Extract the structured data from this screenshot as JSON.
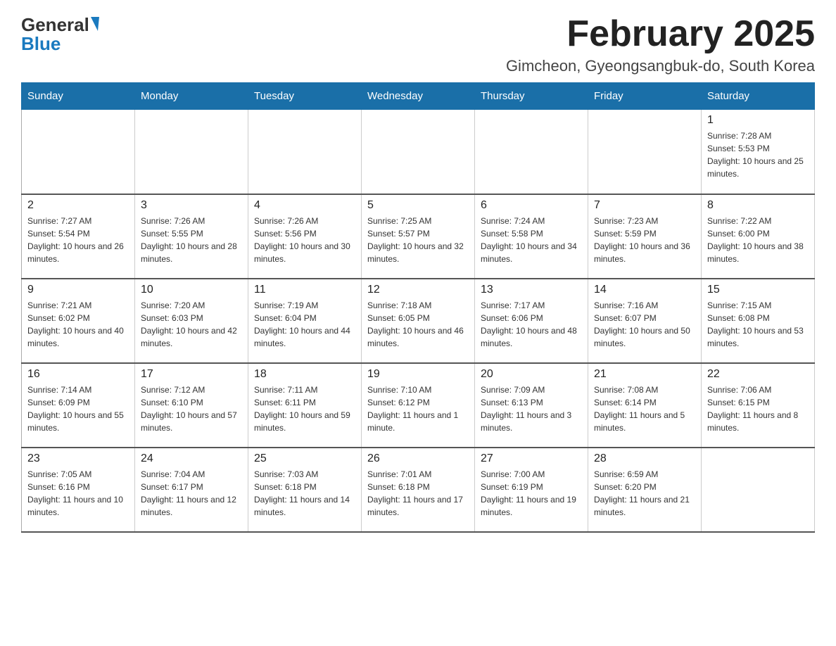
{
  "header": {
    "logo_general": "General",
    "logo_blue": "Blue",
    "title": "February 2025",
    "subtitle": "Gimcheon, Gyeongsangbuk-do, South Korea"
  },
  "calendar": {
    "days_of_week": [
      "Sunday",
      "Monday",
      "Tuesday",
      "Wednesday",
      "Thursday",
      "Friday",
      "Saturday"
    ],
    "weeks": [
      [
        {
          "day": "",
          "sunrise": "",
          "sunset": "",
          "daylight": ""
        },
        {
          "day": "",
          "sunrise": "",
          "sunset": "",
          "daylight": ""
        },
        {
          "day": "",
          "sunrise": "",
          "sunset": "",
          "daylight": ""
        },
        {
          "day": "",
          "sunrise": "",
          "sunset": "",
          "daylight": ""
        },
        {
          "day": "",
          "sunrise": "",
          "sunset": "",
          "daylight": ""
        },
        {
          "day": "",
          "sunrise": "",
          "sunset": "",
          "daylight": ""
        },
        {
          "day": "1",
          "sunrise": "Sunrise: 7:28 AM",
          "sunset": "Sunset: 5:53 PM",
          "daylight": "Daylight: 10 hours and 25 minutes."
        }
      ],
      [
        {
          "day": "2",
          "sunrise": "Sunrise: 7:27 AM",
          "sunset": "Sunset: 5:54 PM",
          "daylight": "Daylight: 10 hours and 26 minutes."
        },
        {
          "day": "3",
          "sunrise": "Sunrise: 7:26 AM",
          "sunset": "Sunset: 5:55 PM",
          "daylight": "Daylight: 10 hours and 28 minutes."
        },
        {
          "day": "4",
          "sunrise": "Sunrise: 7:26 AM",
          "sunset": "Sunset: 5:56 PM",
          "daylight": "Daylight: 10 hours and 30 minutes."
        },
        {
          "day": "5",
          "sunrise": "Sunrise: 7:25 AM",
          "sunset": "Sunset: 5:57 PM",
          "daylight": "Daylight: 10 hours and 32 minutes."
        },
        {
          "day": "6",
          "sunrise": "Sunrise: 7:24 AM",
          "sunset": "Sunset: 5:58 PM",
          "daylight": "Daylight: 10 hours and 34 minutes."
        },
        {
          "day": "7",
          "sunrise": "Sunrise: 7:23 AM",
          "sunset": "Sunset: 5:59 PM",
          "daylight": "Daylight: 10 hours and 36 minutes."
        },
        {
          "day": "8",
          "sunrise": "Sunrise: 7:22 AM",
          "sunset": "Sunset: 6:00 PM",
          "daylight": "Daylight: 10 hours and 38 minutes."
        }
      ],
      [
        {
          "day": "9",
          "sunrise": "Sunrise: 7:21 AM",
          "sunset": "Sunset: 6:02 PM",
          "daylight": "Daylight: 10 hours and 40 minutes."
        },
        {
          "day": "10",
          "sunrise": "Sunrise: 7:20 AM",
          "sunset": "Sunset: 6:03 PM",
          "daylight": "Daylight: 10 hours and 42 minutes."
        },
        {
          "day": "11",
          "sunrise": "Sunrise: 7:19 AM",
          "sunset": "Sunset: 6:04 PM",
          "daylight": "Daylight: 10 hours and 44 minutes."
        },
        {
          "day": "12",
          "sunrise": "Sunrise: 7:18 AM",
          "sunset": "Sunset: 6:05 PM",
          "daylight": "Daylight: 10 hours and 46 minutes."
        },
        {
          "day": "13",
          "sunrise": "Sunrise: 7:17 AM",
          "sunset": "Sunset: 6:06 PM",
          "daylight": "Daylight: 10 hours and 48 minutes."
        },
        {
          "day": "14",
          "sunrise": "Sunrise: 7:16 AM",
          "sunset": "Sunset: 6:07 PM",
          "daylight": "Daylight: 10 hours and 50 minutes."
        },
        {
          "day": "15",
          "sunrise": "Sunrise: 7:15 AM",
          "sunset": "Sunset: 6:08 PM",
          "daylight": "Daylight: 10 hours and 53 minutes."
        }
      ],
      [
        {
          "day": "16",
          "sunrise": "Sunrise: 7:14 AM",
          "sunset": "Sunset: 6:09 PM",
          "daylight": "Daylight: 10 hours and 55 minutes."
        },
        {
          "day": "17",
          "sunrise": "Sunrise: 7:12 AM",
          "sunset": "Sunset: 6:10 PM",
          "daylight": "Daylight: 10 hours and 57 minutes."
        },
        {
          "day": "18",
          "sunrise": "Sunrise: 7:11 AM",
          "sunset": "Sunset: 6:11 PM",
          "daylight": "Daylight: 10 hours and 59 minutes."
        },
        {
          "day": "19",
          "sunrise": "Sunrise: 7:10 AM",
          "sunset": "Sunset: 6:12 PM",
          "daylight": "Daylight: 11 hours and 1 minute."
        },
        {
          "day": "20",
          "sunrise": "Sunrise: 7:09 AM",
          "sunset": "Sunset: 6:13 PM",
          "daylight": "Daylight: 11 hours and 3 minutes."
        },
        {
          "day": "21",
          "sunrise": "Sunrise: 7:08 AM",
          "sunset": "Sunset: 6:14 PM",
          "daylight": "Daylight: 11 hours and 5 minutes."
        },
        {
          "day": "22",
          "sunrise": "Sunrise: 7:06 AM",
          "sunset": "Sunset: 6:15 PM",
          "daylight": "Daylight: 11 hours and 8 minutes."
        }
      ],
      [
        {
          "day": "23",
          "sunrise": "Sunrise: 7:05 AM",
          "sunset": "Sunset: 6:16 PM",
          "daylight": "Daylight: 11 hours and 10 minutes."
        },
        {
          "day": "24",
          "sunrise": "Sunrise: 7:04 AM",
          "sunset": "Sunset: 6:17 PM",
          "daylight": "Daylight: 11 hours and 12 minutes."
        },
        {
          "day": "25",
          "sunrise": "Sunrise: 7:03 AM",
          "sunset": "Sunset: 6:18 PM",
          "daylight": "Daylight: 11 hours and 14 minutes."
        },
        {
          "day": "26",
          "sunrise": "Sunrise: 7:01 AM",
          "sunset": "Sunset: 6:18 PM",
          "daylight": "Daylight: 11 hours and 17 minutes."
        },
        {
          "day": "27",
          "sunrise": "Sunrise: 7:00 AM",
          "sunset": "Sunset: 6:19 PM",
          "daylight": "Daylight: 11 hours and 19 minutes."
        },
        {
          "day": "28",
          "sunrise": "Sunrise: 6:59 AM",
          "sunset": "Sunset: 6:20 PM",
          "daylight": "Daylight: 11 hours and 21 minutes."
        },
        {
          "day": "",
          "sunrise": "",
          "sunset": "",
          "daylight": ""
        }
      ]
    ]
  }
}
